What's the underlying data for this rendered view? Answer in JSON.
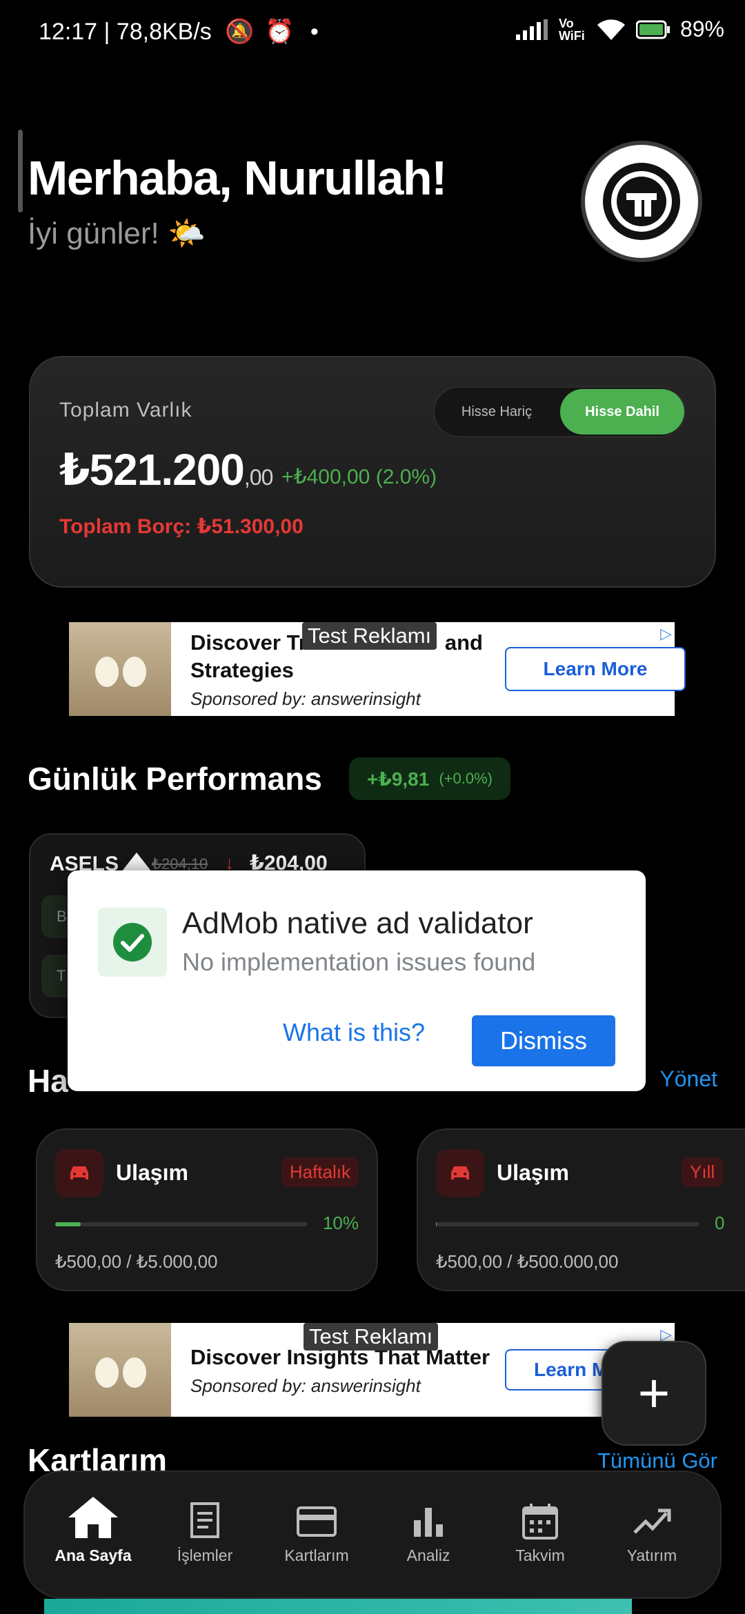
{
  "status_bar": {
    "left_text": "12:17 | 78,8KB/s",
    "network": "Vo WiFi",
    "battery": "89%"
  },
  "header": {
    "greeting": "Merhaba, Nurullah!",
    "subtitle": "İyi günler! 🌤️",
    "avatar_icon": "club-logo-icon"
  },
  "asset_card": {
    "label": "Toplam Varlık",
    "toggle_off": "Hisse Hariç",
    "toggle_on": "Hisse Dahil",
    "value_main": "₺521.200",
    "value_decimal": ",00",
    "change": "+₺400,00 (2.0%)",
    "debt": "Toplam Borç: ₺51.300,00"
  },
  "ad1": {
    "tag": "Test Reklamı",
    "title": "Discover Tr... and Strategies",
    "title_line1": "Discover Tr",
    "title_line1_end": "and",
    "title_line2": "Strategies",
    "sponsor": "Sponsored by: answerinsight",
    "cta": "Learn More"
  },
  "daily": {
    "title": "Günlük Performans",
    "change": "+₺9,81",
    "change_pct": "(+0.0%)",
    "stock": {
      "name": "ASELS",
      "old_price": "₺204,10",
      "new_price": "₺204,00",
      "chip1": "B",
      "chip2": "T"
    }
  },
  "dialog": {
    "title": "AdMob native ad validator",
    "subtitle": "No implementation issues found",
    "link": "What is this?",
    "button": "Dismiss"
  },
  "budgets": {
    "title_partial": "Ha",
    "manage": "Yönet",
    "items": [
      {
        "name": "Ulaşım",
        "period": "Haftalık",
        "pct": "10%",
        "amount": "₺500,00 / ₺5.000,00",
        "progress": 0.1
      },
      {
        "name": "Ulaşım",
        "period": "Yıll",
        "pct": "0",
        "amount": "₺500,00 / ₺500.000,00",
        "progress": 0.001
      }
    ]
  },
  "ad2": {
    "tag": "Test Reklamı",
    "title": "Discover Insights That Matter",
    "sponsor": "Sponsored by: answerinsight",
    "cta": "Learn M"
  },
  "cards_section": {
    "title": "Kartlarım",
    "see_all": "Tümünü Gör"
  },
  "fab": "+",
  "nav": [
    {
      "label": "Ana Sayfa",
      "icon": "home-icon"
    },
    {
      "label": "İşlemler",
      "icon": "receipt-icon"
    },
    {
      "label": "Kartlarım",
      "icon": "card-icon"
    },
    {
      "label": "Analiz",
      "icon": "bar-chart-icon"
    },
    {
      "label": "Takvim",
      "icon": "calendar-icon"
    },
    {
      "label": "Yatırım",
      "icon": "trend-up-icon"
    }
  ]
}
